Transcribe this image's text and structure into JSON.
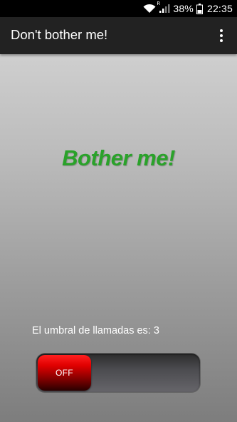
{
  "status_bar": {
    "battery_percent": "38%",
    "time": "22:35",
    "icons": [
      "wifi-icon",
      "signal-icon",
      "battery-icon"
    ],
    "signal_roaming_marker": "R"
  },
  "app_bar": {
    "title": "Don't bother me!",
    "menu_icon": "overflow-menu-icon"
  },
  "main": {
    "headline": "Bother me!",
    "headline_color": "#2aa22a",
    "threshold_label": "El umbral de llamadas es: 3",
    "toggle": {
      "state_label": "OFF",
      "checked": false,
      "thumb_color": "#e00000"
    }
  }
}
